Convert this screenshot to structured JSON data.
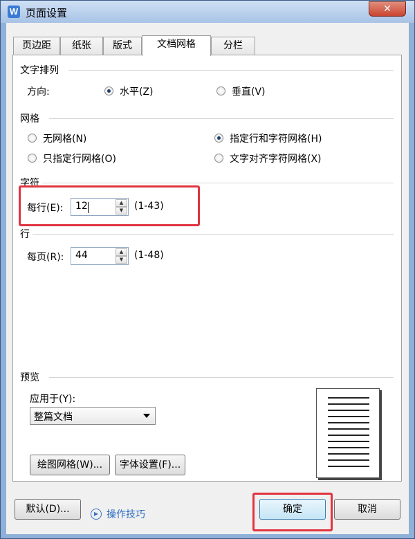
{
  "window": {
    "title": "页面设置",
    "app_icon": "W",
    "close": "✕"
  },
  "tabs": [
    {
      "label": "页边距"
    },
    {
      "label": "纸张"
    },
    {
      "label": "版式"
    },
    {
      "label": "文档网格"
    },
    {
      "label": "分栏"
    }
  ],
  "active_tab": "文档网格",
  "text_direction": {
    "section": "文字排列",
    "label": "方向:",
    "options": [
      {
        "label": "水平(Z)",
        "selected": true
      },
      {
        "label": "垂直(V)",
        "selected": false
      }
    ]
  },
  "grid": {
    "section": "网格",
    "options": [
      {
        "label": "无网格(N)",
        "selected": false
      },
      {
        "label": "指定行和字符网格(H)",
        "selected": true
      },
      {
        "label": "只指定行网格(O)",
        "selected": false
      },
      {
        "label": "文字对齐字符网格(X)",
        "selected": false
      }
    ]
  },
  "chars": {
    "section": "字符",
    "label": "每行(E):",
    "value": "12",
    "range": "(1-43)"
  },
  "lines": {
    "section": "行",
    "label": "每页(R):",
    "value": "44",
    "range": "(1-48)"
  },
  "preview": {
    "section": "预览",
    "apply_label": "应用于(Y):",
    "apply_value": "整篇文档",
    "draw_grid_button": "绘图网格(W)...",
    "font_settings_button": "字体设置(F)..."
  },
  "footer": {
    "default_button": "默认(D)...",
    "tips_link": "操作技巧",
    "ok_button": "确定",
    "cancel_button": "取消"
  },
  "colors": {
    "highlight": "#e0343f",
    "link": "#2a6cc0",
    "accent": "#3a7bd5"
  }
}
